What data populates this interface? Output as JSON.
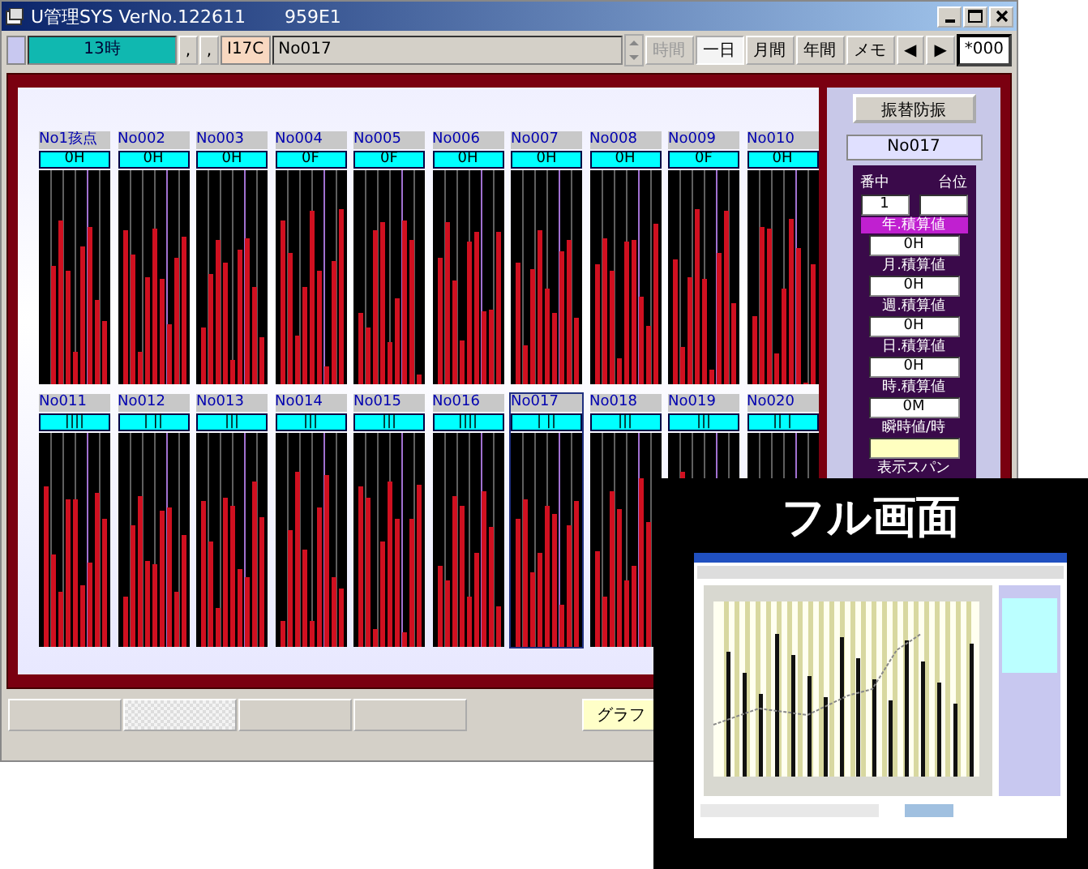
{
  "window": {
    "title": "U管理SYS  VerNo.122611",
    "subtitle": "959E1"
  },
  "toolbar": {
    "hour": "13時",
    "sep_buttons": [
      ",",
      ","
    ],
    "code": "I17C",
    "point": "No017",
    "buttons": [
      {
        "label": "時間",
        "disabled": true,
        "selected": false
      },
      {
        "label": "一日",
        "disabled": false,
        "selected": true
      },
      {
        "label": "月間",
        "disabled": false,
        "selected": false
      },
      {
        "label": "年間",
        "disabled": false,
        "selected": false
      },
      {
        "label": "メモ",
        "disabled": false,
        "selected": false
      },
      {
        "label": "◀",
        "disabled": false,
        "selected": false
      },
      {
        "label": "▶",
        "disabled": false,
        "selected": false
      }
    ],
    "counter": "*000"
  },
  "charts": [
    {
      "label": "No1孩点",
      "value": "0H",
      "selected": false
    },
    {
      "label": "No002",
      "value": "0H",
      "selected": false
    },
    {
      "label": "No003",
      "value": "0H",
      "selected": false
    },
    {
      "label": "No004",
      "value": "0F",
      "selected": false
    },
    {
      "label": "No005",
      "value": "0F",
      "selected": false
    },
    {
      "label": "No006",
      "value": "0H",
      "selected": false
    },
    {
      "label": "No007",
      "value": "0H",
      "selected": false
    },
    {
      "label": "No008",
      "value": "0H",
      "selected": false
    },
    {
      "label": "No009",
      "value": "0F",
      "selected": false
    },
    {
      "label": "No010",
      "value": "0H",
      "selected": false
    },
    {
      "label": "No011",
      "value": "||||",
      "selected": false
    },
    {
      "label": "No012",
      "value": "| ||",
      "selected": false
    },
    {
      "label": "No013",
      "value": "|||",
      "selected": false
    },
    {
      "label": "No014",
      "value": "|||",
      "selected": false
    },
    {
      "label": "No015",
      "value": "|||",
      "selected": false
    },
    {
      "label": "No016",
      "value": "||||",
      "selected": false
    },
    {
      "label": "No017",
      "value": "| ||",
      "selected": true
    },
    {
      "label": "No018",
      "value": "|||",
      "selected": false
    },
    {
      "label": "No019",
      "value": "|||",
      "selected": false
    },
    {
      "label": "No020",
      "value": "|| |",
      "selected": false
    }
  ],
  "side_panel": {
    "button": "振替防振",
    "point": "No017",
    "col_1": "番中",
    "col_2": "台位",
    "field_1": "1",
    "values": [
      {
        "label": "年.積算値",
        "value": "0H",
        "selected": true
      },
      {
        "label": "月.積算値",
        "value": "0H",
        "selected": false
      },
      {
        "label": "週.積算値",
        "value": "0H",
        "selected": false
      },
      {
        "label": "日.積算値",
        "value": "0H",
        "selected": false
      },
      {
        "label": "時.積算値",
        "value": "0M",
        "selected": false
      }
    ],
    "instant_label": "瞬時値/時",
    "span_label": "表示スパン"
  },
  "bottom_tabs": [
    {
      "selected": false
    },
    {
      "selected": true
    },
    {
      "selected": false
    },
    {
      "selected": false
    }
  ],
  "graph_button": "グラフ",
  "overlay": {
    "caption": "フル画面"
  }
}
